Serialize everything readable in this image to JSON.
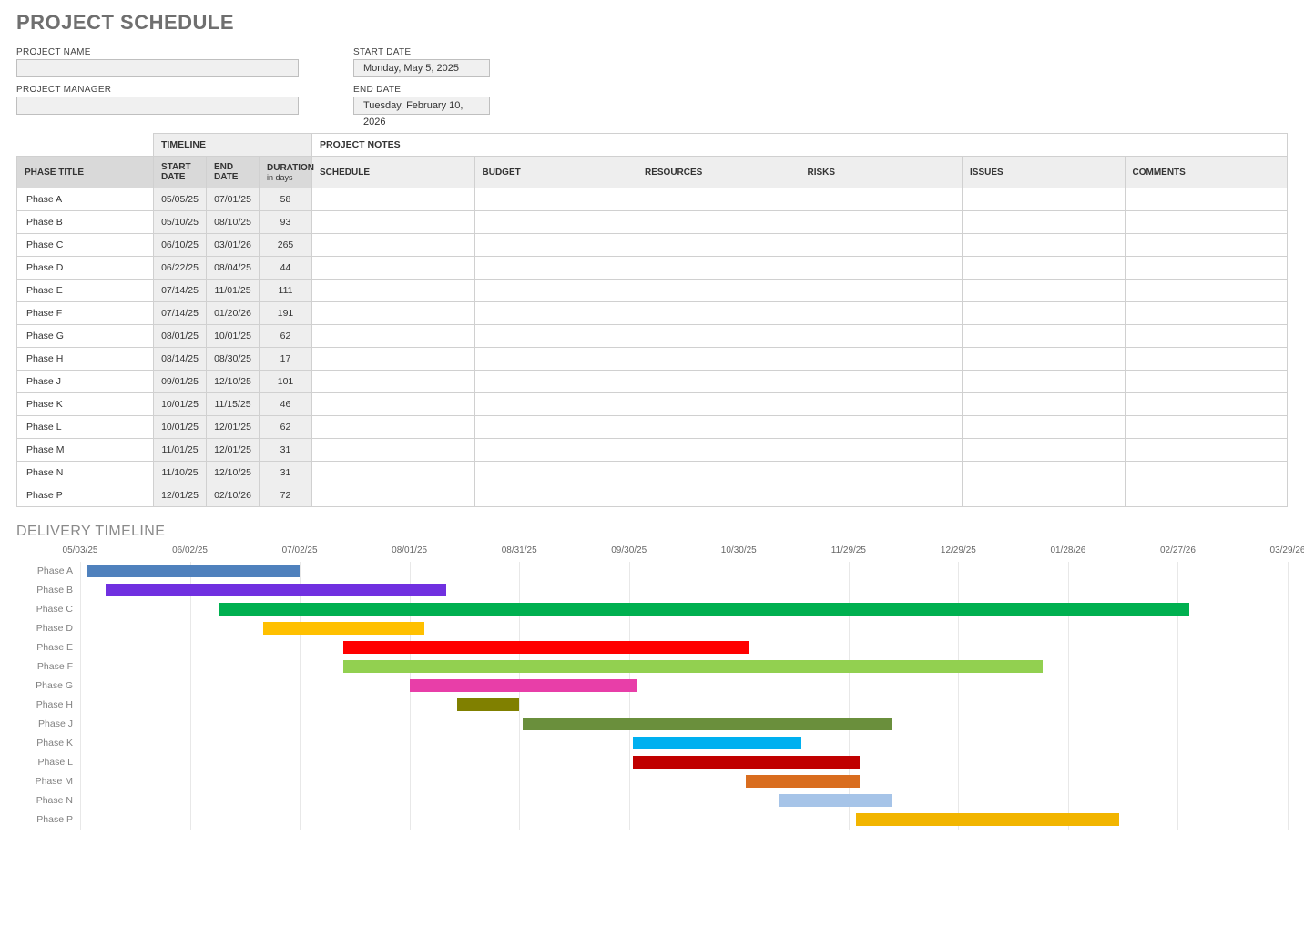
{
  "title": "PROJECT SCHEDULE",
  "meta": {
    "project_name_label": "PROJECT NAME",
    "project_name_value": "",
    "project_manager_label": "PROJECT MANAGER",
    "project_manager_value": "",
    "start_date_label": "START DATE",
    "start_date_value": "Monday, May 5, 2025",
    "end_date_label": "END DATE",
    "end_date_value": "Tuesday, February 10, 2026"
  },
  "table": {
    "timeline_header": "TIMELINE",
    "notes_header": "PROJECT NOTES",
    "phase_title_header": "PHASE TITLE",
    "start_header": "START DATE",
    "end_header": "END DATE",
    "duration_header": "DURATION",
    "duration_sub": "in days",
    "schedule_header": "SCHEDULE",
    "budget_header": "BUDGET",
    "resources_header": "RESOURCES",
    "risks_header": "RISKS",
    "issues_header": "ISSUES",
    "comments_header": "COMMENTS",
    "rows": [
      {
        "title": "Phase A",
        "start": "05/05/25",
        "end": "07/01/25",
        "duration": "58"
      },
      {
        "title": "Phase B",
        "start": "05/10/25",
        "end": "08/10/25",
        "duration": "93"
      },
      {
        "title": "Phase C",
        "start": "06/10/25",
        "end": "03/01/26",
        "duration": "265"
      },
      {
        "title": "Phase D",
        "start": "06/22/25",
        "end": "08/04/25",
        "duration": "44"
      },
      {
        "title": "Phase E",
        "start": "07/14/25",
        "end": "11/01/25",
        "duration": "111"
      },
      {
        "title": "Phase F",
        "start": "07/14/25",
        "end": "01/20/26",
        "duration": "191"
      },
      {
        "title": "Phase G",
        "start": "08/01/25",
        "end": "10/01/25",
        "duration": "62"
      },
      {
        "title": "Phase H",
        "start": "08/14/25",
        "end": "08/30/25",
        "duration": "17"
      },
      {
        "title": "Phase J",
        "start": "09/01/25",
        "end": "12/10/25",
        "duration": "101"
      },
      {
        "title": "Phase K",
        "start": "10/01/25",
        "end": "11/15/25",
        "duration": "46"
      },
      {
        "title": "Phase L",
        "start": "10/01/25",
        "end": "12/01/25",
        "duration": "62"
      },
      {
        "title": "Phase M",
        "start": "11/01/25",
        "end": "12/01/25",
        "duration": "31"
      },
      {
        "title": "Phase N",
        "start": "11/10/25",
        "end": "12/10/25",
        "duration": "31"
      },
      {
        "title": "Phase P",
        "start": "12/01/25",
        "end": "02/10/26",
        "duration": "72"
      }
    ]
  },
  "delivery_title": "DELIVERY TIMELINE",
  "chart_data": {
    "type": "gantt",
    "x_axis_start": "05/03/25",
    "x_axis_end": "03/29/26",
    "ticks": [
      "05/03/25",
      "06/02/25",
      "07/02/25",
      "08/01/25",
      "08/31/25",
      "09/30/25",
      "10/30/25",
      "11/29/25",
      "12/29/25",
      "01/28/26",
      "02/27/26",
      "03/29/26"
    ],
    "bars": [
      {
        "label": "Phase A",
        "start": "05/05/25",
        "duration": 58,
        "color": "#4f81bd"
      },
      {
        "label": "Phase B",
        "start": "05/10/25",
        "duration": 93,
        "color": "#7030e0"
      },
      {
        "label": "Phase C",
        "start": "06/10/25",
        "duration": 265,
        "color": "#00b050"
      },
      {
        "label": "Phase D",
        "start": "06/22/25",
        "duration": 44,
        "color": "#ffc000"
      },
      {
        "label": "Phase E",
        "start": "07/14/25",
        "duration": 111,
        "color": "#ff0000"
      },
      {
        "label": "Phase F",
        "start": "07/14/25",
        "duration": 191,
        "color": "#92d050"
      },
      {
        "label": "Phase G",
        "start": "08/01/25",
        "duration": 62,
        "color": "#e83ea8"
      },
      {
        "label": "Phase H",
        "start": "08/14/25",
        "duration": 17,
        "color": "#808000"
      },
      {
        "label": "Phase J",
        "start": "09/01/25",
        "duration": 101,
        "color": "#6a8f3c"
      },
      {
        "label": "Phase K",
        "start": "10/01/25",
        "duration": 46,
        "color": "#00b0f0"
      },
      {
        "label": "Phase L",
        "start": "10/01/25",
        "duration": 62,
        "color": "#c00000"
      },
      {
        "label": "Phase M",
        "start": "11/01/25",
        "duration": 31,
        "color": "#d96d1f"
      },
      {
        "label": "Phase N",
        "start": "11/10/25",
        "duration": 31,
        "color": "#a6c4e8"
      },
      {
        "label": "Phase P",
        "start": "12/01/25",
        "duration": 72,
        "color": "#f2b500"
      }
    ]
  }
}
